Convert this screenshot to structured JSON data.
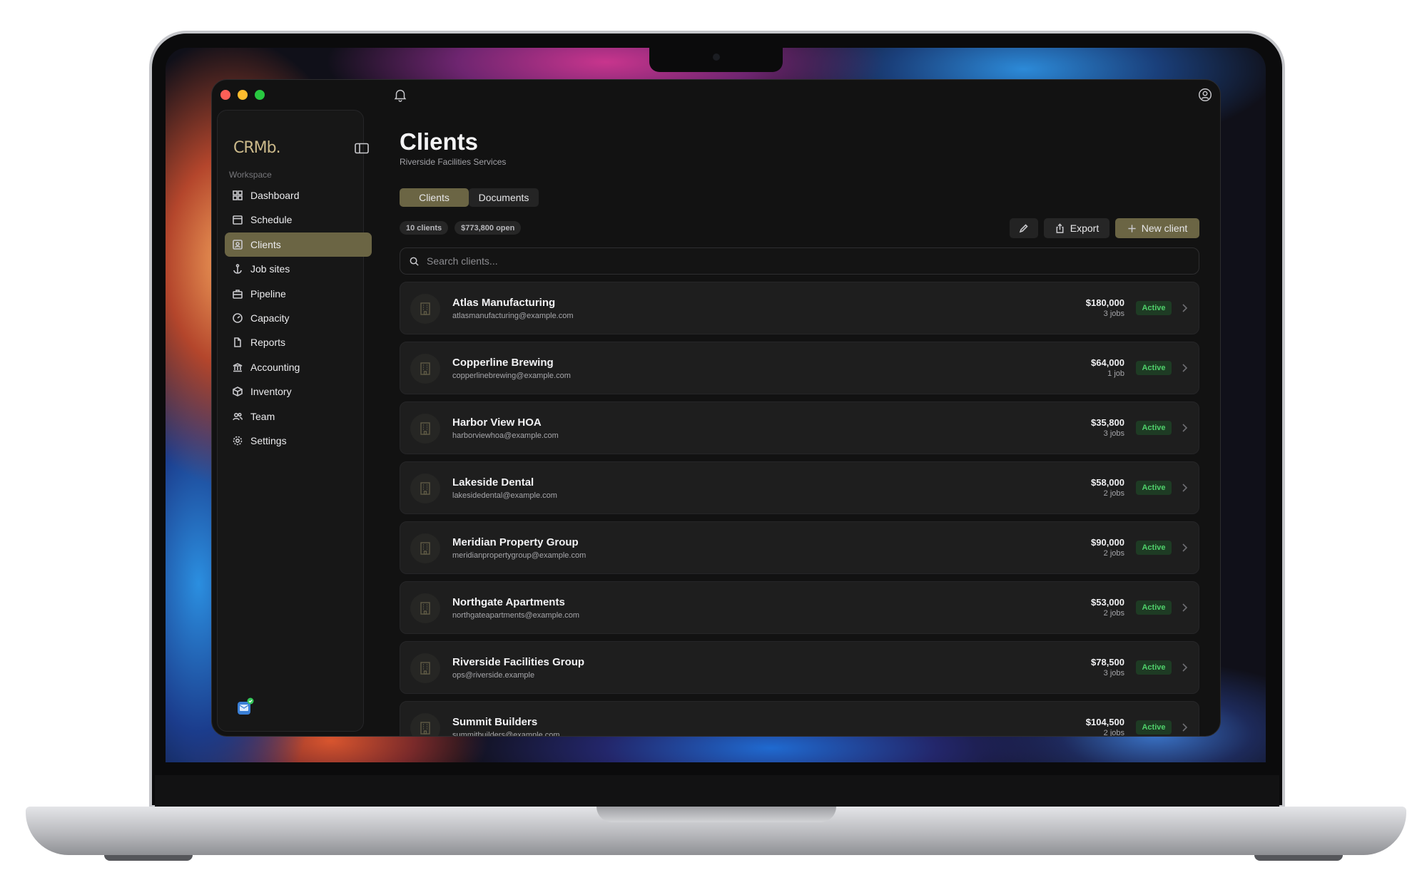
{
  "window": {
    "traffic_lights": [
      "close",
      "minimize",
      "zoom"
    ],
    "toolbar_icons": [
      "bell-icon",
      "user-circle-icon"
    ]
  },
  "sidebar": {
    "logo": "CRMb.",
    "section_label": "Workspace",
    "items": [
      {
        "label": "Dashboard",
        "icon": "grid-icon"
      },
      {
        "label": "Schedule",
        "icon": "calendar-icon"
      },
      {
        "label": "Clients",
        "icon": "contact-card-icon",
        "active": true
      },
      {
        "label": "Job sites",
        "icon": "anchor-icon"
      },
      {
        "label": "Pipeline",
        "icon": "briefcase-icon"
      },
      {
        "label": "Capacity",
        "icon": "gauge-icon"
      },
      {
        "label": "Reports",
        "icon": "document-icon"
      },
      {
        "label": "Accounting",
        "icon": "bank-icon"
      },
      {
        "label": "Inventory",
        "icon": "box-icon"
      },
      {
        "label": "Team",
        "icon": "users-icon"
      },
      {
        "label": "Settings",
        "icon": "gear-icon"
      }
    ]
  },
  "main": {
    "title": "Clients",
    "subtitle": "Riverside Facilities Services",
    "tabs": [
      {
        "label": "Clients",
        "active": true
      },
      {
        "label": "Documents"
      }
    ],
    "chips": [
      "10 clients",
      "$773,800 open"
    ],
    "actions": {
      "export_label": "Export",
      "new_label": "New client"
    },
    "search": {
      "placeholder": "Search clients...",
      "value": ""
    },
    "clients": [
      {
        "name": "Atlas Manufacturing",
        "email": "atlasmanufacturing@example.com",
        "amount": "$180,000",
        "jobs": "3 jobs",
        "status": "Active"
      },
      {
        "name": "Copperline Brewing",
        "email": "copperlinebrewing@example.com",
        "amount": "$64,000",
        "jobs": "1 job",
        "status": "Active"
      },
      {
        "name": "Harbor View HOA",
        "email": "harborviewhoa@example.com",
        "amount": "$35,800",
        "jobs": "3 jobs",
        "status": "Active"
      },
      {
        "name": "Lakeside Dental",
        "email": "lakesidedental@example.com",
        "amount": "$58,000",
        "jobs": "2 jobs",
        "status": "Active"
      },
      {
        "name": "Meridian Property Group",
        "email": "meridianpropertygroup@example.com",
        "amount": "$90,000",
        "jobs": "2 jobs",
        "status": "Active"
      },
      {
        "name": "Northgate Apartments",
        "email": "northgateapartments@example.com",
        "amount": "$53,000",
        "jobs": "2 jobs",
        "status": "Active"
      },
      {
        "name": "Riverside Facilities Group",
        "email": "ops@riverside.example",
        "amount": "$78,500",
        "jobs": "3 jobs",
        "status": "Active"
      },
      {
        "name": "Summit Builders",
        "email": "summitbuilders@example.com",
        "amount": "$104,500",
        "jobs": "2 jobs",
        "status": "Active"
      }
    ]
  },
  "colors": {
    "accent": "#6b6544",
    "active_badge_bg": "#1e3b24",
    "active_badge_text": "#4fd06a",
    "window_bg": "#121212"
  }
}
